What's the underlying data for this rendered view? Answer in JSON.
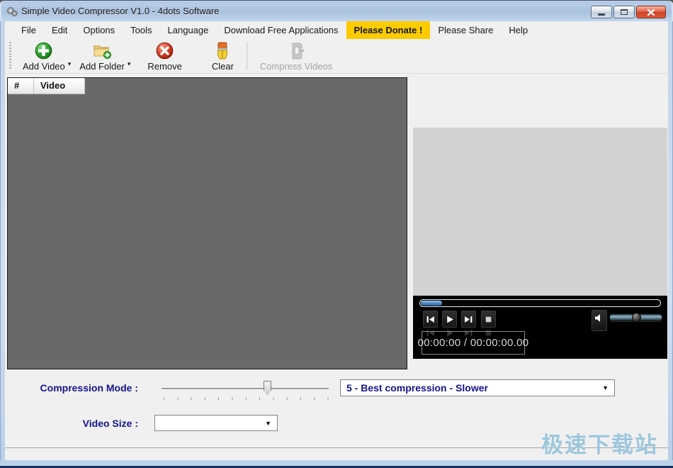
{
  "window": {
    "title": "Simple Video Compressor V1.0 - 4dots Software"
  },
  "menu": {
    "items": [
      {
        "label": "File"
      },
      {
        "label": "Edit"
      },
      {
        "label": "Options"
      },
      {
        "label": "Tools"
      },
      {
        "label": "Language"
      },
      {
        "label": "Download Free Applications"
      },
      {
        "label": "Please Donate !",
        "highlighted": true
      },
      {
        "label": "Please Share"
      },
      {
        "label": "Help"
      }
    ]
  },
  "toolbar": {
    "buttons": [
      {
        "label": "Add Video",
        "icon": "add-video-icon",
        "has_dropdown": true,
        "disabled": false
      },
      {
        "label": "Add Folder",
        "icon": "add-folder-icon",
        "has_dropdown": true,
        "disabled": false
      },
      {
        "label": "Remove",
        "icon": "remove-icon",
        "has_dropdown": false,
        "disabled": false
      },
      {
        "label": "Clear",
        "icon": "clear-brush-icon",
        "has_dropdown": false,
        "disabled": false
      },
      {
        "label": "Compress Videos",
        "icon": "compress-icon",
        "has_dropdown": false,
        "disabled": true
      }
    ]
  },
  "file_list": {
    "columns": [
      "#",
      "Video"
    ],
    "rows": []
  },
  "player": {
    "time_display": "00:00:00 / 00:00:00.00",
    "seek_position_percent": 2,
    "volume_percent": 46,
    "buttons": [
      "skip-back",
      "play",
      "skip-forward",
      "stop",
      "mute"
    ]
  },
  "compression_mode": {
    "label": "Compression Mode :",
    "slider_value": 5,
    "selected_option": "5 - Best compression - Slower"
  },
  "video_size": {
    "label": "Video Size :",
    "selected_option": ""
  },
  "watermark": {
    "text": "极速下载站"
  },
  "colors": {
    "donate_highlight": "#fccc00",
    "label_navy": "#14148c",
    "list_background": "#696969",
    "preview_background": "#d2d2d2",
    "player_background": "#000000",
    "titlebar_blue": "#aac2de"
  }
}
